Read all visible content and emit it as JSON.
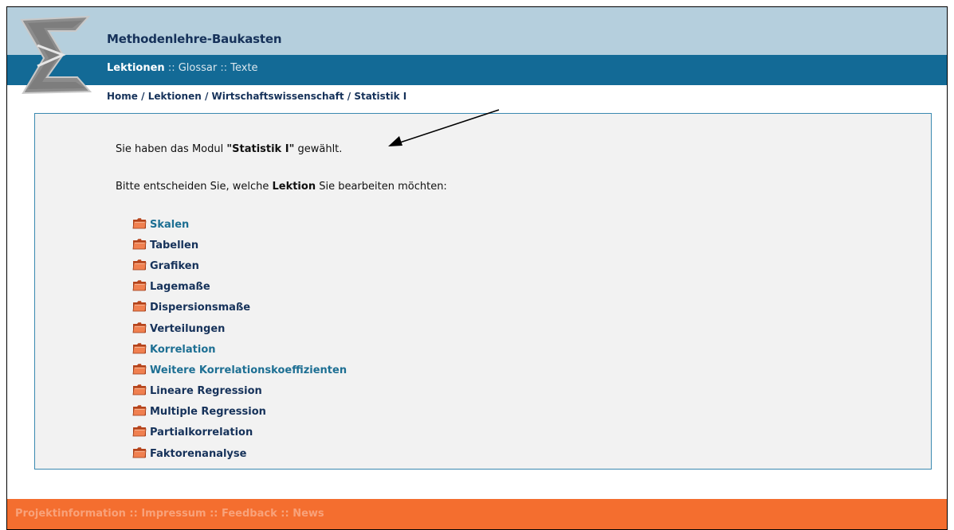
{
  "header": {
    "site_title": "Methodenlehre-Baukasten",
    "nav": {
      "lektionen": "Lektionen",
      "sep1": " :: ",
      "glossar": "Glossar",
      "sep2": " :: ",
      "texte": "Texte"
    },
    "breadcrumb": {
      "home": "Home",
      "sep1": " / ",
      "lektionen": "Lektionen",
      "sep2": " / ",
      "fach": "Wirtschaftswissenschaft",
      "sep3": " / ",
      "modul": "Statistik I"
    }
  },
  "main": {
    "intro_before": "Sie haben das Modul ",
    "intro_module": "\"Statistik I\"",
    "intro_after": " gewählt.",
    "ask_before": "Bitte entscheiden Sie, welche ",
    "ask_bold": "Lektion",
    "ask_after": " Sie bearbeiten möchten:",
    "lessons": [
      {
        "label": "Skalen"
      },
      {
        "label": "Tabellen"
      },
      {
        "label": "Grafiken"
      },
      {
        "label": "Lagemaße"
      },
      {
        "label": "Dispersionsmaße"
      },
      {
        "label": "Verteilungen"
      },
      {
        "label": "Korrelation"
      },
      {
        "label": "Weitere Korrelationskoeffizienten"
      },
      {
        "label": "Lineare Regression"
      },
      {
        "label": "Multiple Regression"
      },
      {
        "label": "Partialkorrelation"
      },
      {
        "label": "Faktorenanalyse"
      }
    ]
  },
  "footer": {
    "projektinfo": "Projektinformation",
    "sep1": " :: ",
    "impressum": "Impressum",
    "sep2": " :: ",
    "feedback": "Feedback",
    "sep3": " :: ",
    "news": "News"
  },
  "icons": {
    "logo": "sigma-logo",
    "lesson": "folder-icon",
    "annotation": "arrow-annotation"
  },
  "colors": {
    "top_band": "#b5cfdd",
    "nav_band": "#136a96",
    "footer": "#f46e2f",
    "link_teal": "#1d6f93",
    "link_navy": "#16325a",
    "content_border": "#3a89b0"
  }
}
